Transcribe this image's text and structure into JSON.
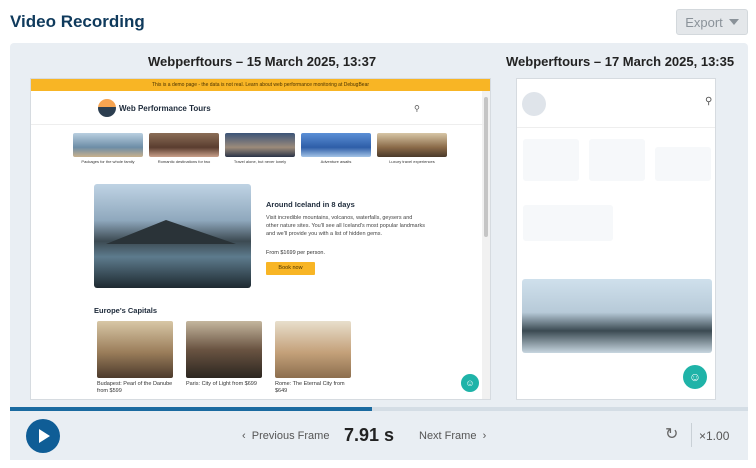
{
  "title": "Video Recording",
  "export_label": "Export",
  "frames": [
    {
      "caption": "Webperftours – 15 March 2025, 13:37",
      "banner": "This is a demo page - the data is not real. Learn about web performance monitoring at DebugBear",
      "site_name": "Web Performance Tours",
      "thumbs": [
        "Packages for the whole family",
        "Romantic destinations for two",
        "Travel alone, but never lonely",
        "Adventure awaits",
        "Luxury travel experiences"
      ],
      "hero_title": "Around Iceland in 8 days",
      "hero_desc": "Visit incredible mountains, volcanos, waterfalls, geysers and other nature sites. You'll see all Iceland's most popular landmarks and we'll provide you with a list of hidden gems.",
      "hero_price": "From $1699 per person.",
      "hero_button": "Book now",
      "capitals_title": "Europe's Capitals",
      "capitals": [
        "Budapest: Pearl of the Danube from $599",
        "Paris: City of Light from $699",
        "Rome: The Eternal City from $649"
      ]
    },
    {
      "caption": "Webperftours – 17 March 2025, 13:35"
    }
  ],
  "player": {
    "prev_label": "Previous Frame",
    "time": "7.91 s",
    "next_label": "Next Frame",
    "speed": "×1.00",
    "progress": 0.49
  },
  "icons": {
    "play": "play-icon",
    "prev": "chevron-left-icon",
    "next": "chevron-right-icon",
    "reload": "reload-icon",
    "chat": "chat-icon",
    "search": "search-icon",
    "export_dropdown": "chevron-down-icon"
  },
  "colors": {
    "brand_navy": "#0f3a5c",
    "play_blue": "#0f5d96",
    "banner_yellow": "#f8b525",
    "chat_teal": "#1fb3a8"
  }
}
